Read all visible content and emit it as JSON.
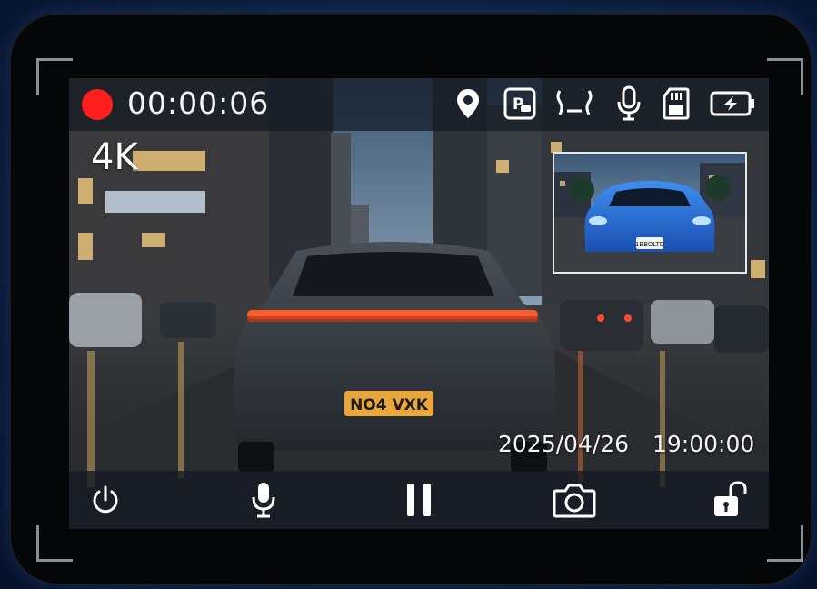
{
  "recording": {
    "status": "recording",
    "elapsed": "00:00:06",
    "resolution": "4K"
  },
  "status_icons": [
    "location-pin-icon",
    "parking-mode-icon",
    "g-sensor-icon",
    "microphone-icon",
    "sd-card-icon",
    "power-charging-icon"
  ],
  "rear_camera": {
    "plate": "1BBOLTD"
  },
  "front_view": {
    "plate": "NO4 VXK"
  },
  "timestamp": {
    "date": "2025/04/26",
    "time": "19:00:00"
  },
  "controls": [
    "power-button",
    "microphone-button",
    "pause-button",
    "snapshot-button",
    "lock-button"
  ],
  "colors": {
    "rec": "#ff1f1f",
    "bar": "#141a24",
    "text": "#f2f4f6"
  }
}
